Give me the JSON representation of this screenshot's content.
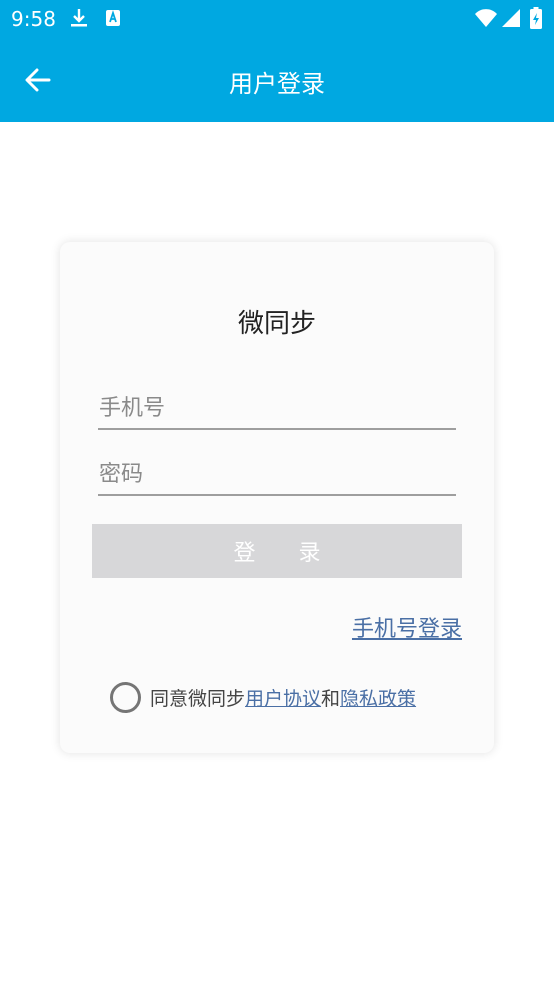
{
  "status": {
    "time": "9:58"
  },
  "appbar": {
    "title": "用户登录"
  },
  "card": {
    "brand": "微同步",
    "phone_placeholder": "手机号",
    "password_placeholder": "密码",
    "login_label": "登 录",
    "switch_link": "手机号登录",
    "agree_text": "同意微同步",
    "agree_terms": "用户协议",
    "agree_and": "和",
    "agree_privacy": "隐私政策"
  },
  "colors": {
    "accent": "#00a8e1",
    "link": "#4a6fa5",
    "button_disabled": "#d7d7d9"
  }
}
